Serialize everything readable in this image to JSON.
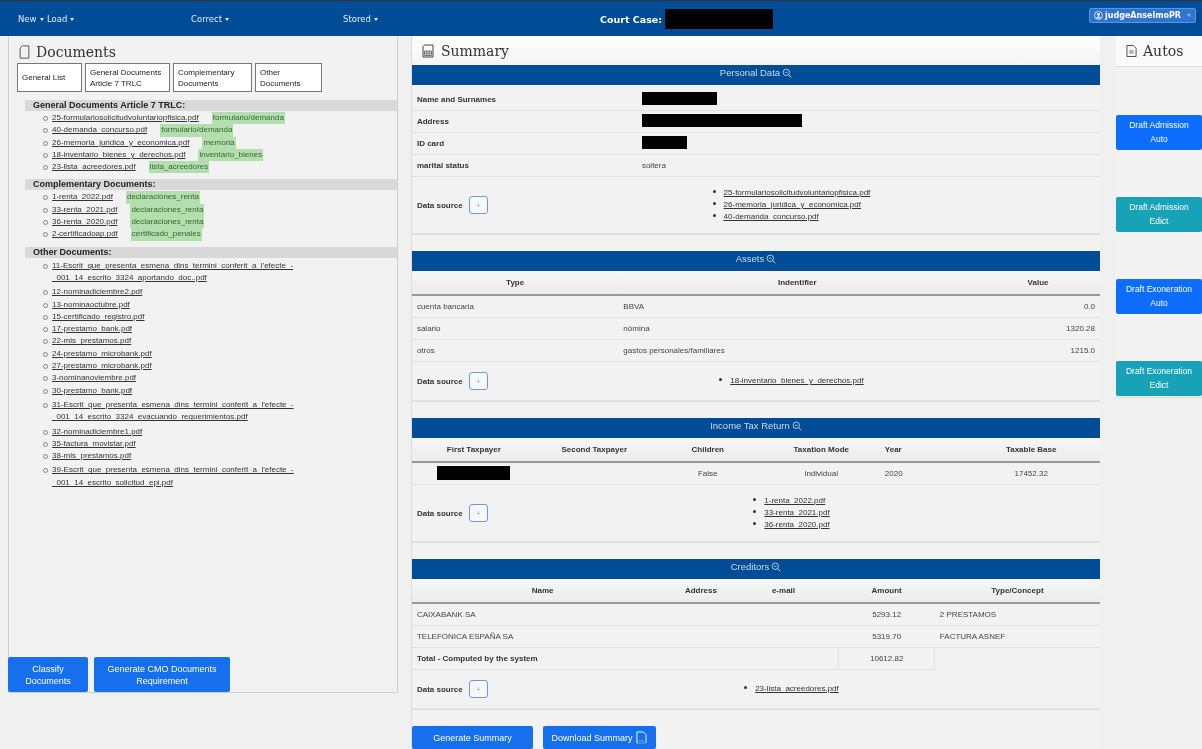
{
  "navbar": {
    "menus": [
      {
        "label": "New"
      },
      {
        "label": "Load"
      },
      {
        "label": "Correct"
      },
      {
        "label": "Stored"
      }
    ],
    "court_case": {
      "label": "Court Case:",
      "redacted": true
    },
    "user": {
      "label": "judgeAnselmoPR"
    }
  },
  "documents": {
    "title": "Documents",
    "tabs": [
      {
        "label": "General List"
      },
      {
        "label": "General Documents Article 7 TRLC"
      },
      {
        "label": "Complementary Documents"
      },
      {
        "label": "Other Documents"
      }
    ],
    "groups": [
      {
        "title": "General Documents Article 7 TRLC:",
        "items": [
          {
            "file": "25-formulariosolicitudvoluntariopfisica.pdf",
            "tag": "formulario/demanda"
          },
          {
            "file": "40-demanda_concurso.pdf",
            "tag": "formulario/demanda"
          },
          {
            "file": "26-memoria_juridica_y_economica.pdf",
            "tag": "memoria"
          },
          {
            "file": "18-inventario_bienes_y_derechos.pdf",
            "tag": "inventario_bienes"
          },
          {
            "file": "23-lista_acreedores.pdf",
            "tag": "lista_acreedores"
          }
        ]
      },
      {
        "title": "Complementary Documents:",
        "items": [
          {
            "file": "1-renta_2022.pdf",
            "tag": "declaraciones_renta"
          },
          {
            "file": "33-renta_2021.pdf",
            "tag": "declaraciones_renta"
          },
          {
            "file": "36-renta_2020.pdf",
            "tag": "declaraciones_renta"
          },
          {
            "file": "2-certificadoap.pdf",
            "tag": "certificado_penales"
          }
        ]
      },
      {
        "title": "Other Documents:",
        "items": [
          {
            "file": "11-Escrit_que_presenta_esmena_dins_termini_conferit_a_l'efecte_-_001_14_escrito_3324_aportando_doc..pdf"
          },
          {
            "file": "12-nominadiciembre2.pdf"
          },
          {
            "file": "13-nominaoctubre.pdf"
          },
          {
            "file": "15-certificado_registro.pdf"
          },
          {
            "file": "17-prestamo_bank.pdf"
          },
          {
            "file": "22-mis_prestamos.pdf"
          },
          {
            "file": "24-prestamo_microbank.pdf"
          },
          {
            "file": "27-prestamo_microbank.pdf"
          },
          {
            "file": "3-nominanoviembre.pdf"
          },
          {
            "file": "30-prestamo_bank.pdf"
          },
          {
            "file": "31-Escrit_que_presenta_esmena_dins_termini_conferit_a_l'efecte_-_001_14_escrito_3324_evacuando_requerimientos.pdf"
          },
          {
            "file": "32-nominadiciembre1.pdf"
          },
          {
            "file": "35-factura_movistar.pdf"
          },
          {
            "file": "38-mis_prestamos.pdf"
          },
          {
            "file": "39-Escrit_que_presenta_esmena_dins_termini_conferit_a_l'efecte_-_001_14_escrito_solicitud_epi.pdf"
          }
        ]
      }
    ],
    "buttons": [
      {
        "label": "Classify Documents"
      },
      {
        "label": "Generate CMO Documents Requirement"
      }
    ]
  },
  "summary": {
    "title": "Summary",
    "sections": [
      {
        "kind": "fields",
        "title": "Personal Data",
        "fields": [
          {
            "label": "Name and Surnames",
            "redacted": true
          },
          {
            "label": "Address",
            "redacted": true
          },
          {
            "label": "ID card",
            "redacted": true
          },
          {
            "label": "marital status",
            "value": "soltera"
          }
        ],
        "source_label": "Data source",
        "add": "+",
        "sources": [
          "25-formulariosolicitudvoluntariopfisica.pdf",
          "26-memoria_juridica_y_economica.pdf",
          "40-demanda_concurso.pdf"
        ]
      },
      {
        "kind": "table",
        "title": "Assets",
        "columns": [
          "Type",
          "Indentifier",
          "Value"
        ],
        "rows": [
          [
            "cuenta bancaria",
            "BBVA",
            "0.0"
          ],
          [
            "salario",
            "nómina",
            "1320.28"
          ],
          [
            "otros",
            "gastos personales/familiares",
            "1215.0"
          ]
        ],
        "source_label": "Data source",
        "add": "+",
        "sources": [
          "18-inventario_bienes_y_derechos.pdf"
        ]
      },
      {
        "kind": "table",
        "title": "Income Tax Return",
        "columns": [
          "First Taxpayer",
          "Second Taxpayer",
          "Children",
          "Taxation Mode",
          "Year",
          "Taxable Base"
        ],
        "rows": [
          [
            {
              "redacted": true
            },
            null,
            "False",
            "individual",
            "2020",
            "17452.32"
          ]
        ],
        "source_label": "Data source",
        "add": "+",
        "sources": [
          "1-renta_2022.pdf",
          "33-renta_2021.pdf",
          "36-renta_2020.pdf"
        ]
      },
      {
        "kind": "table",
        "title": "Creditors",
        "columns": [
          "Name",
          "Address",
          "e-mail",
          "Amount",
          "Type/Concept"
        ],
        "rows": [
          [
            "CAIXABANK SA",
            null,
            null,
            "5293.12",
            "2 PRESTAMOS"
          ],
          [
            "TELEFONICA ESPAÑA SA",
            null,
            null,
            "5319.70",
            "FACTURA ASNEF"
          ]
        ],
        "total": {
          "label": "Total - Computed by the system",
          "amount": "10612.82"
        },
        "source_label": "Data source",
        "add": "+",
        "sources": [
          "23-lista_acreedores.pdf"
        ]
      }
    ],
    "buttons": [
      {
        "label": "Generate Summary",
        "kind": "plain"
      },
      {
        "label": "Download Summary",
        "kind": "download"
      }
    ]
  },
  "autos": {
    "title": "Autos",
    "buttons": [
      {
        "label": "Draft Admission Auto",
        "kind": "primary"
      },
      {
        "label": "Draft Admission Edict",
        "kind": "info"
      },
      {
        "label": "Draft Exoneration Auto",
        "kind": "primary"
      },
      {
        "label": "Draft Exoneration Edict",
        "kind": "info"
      }
    ]
  }
}
